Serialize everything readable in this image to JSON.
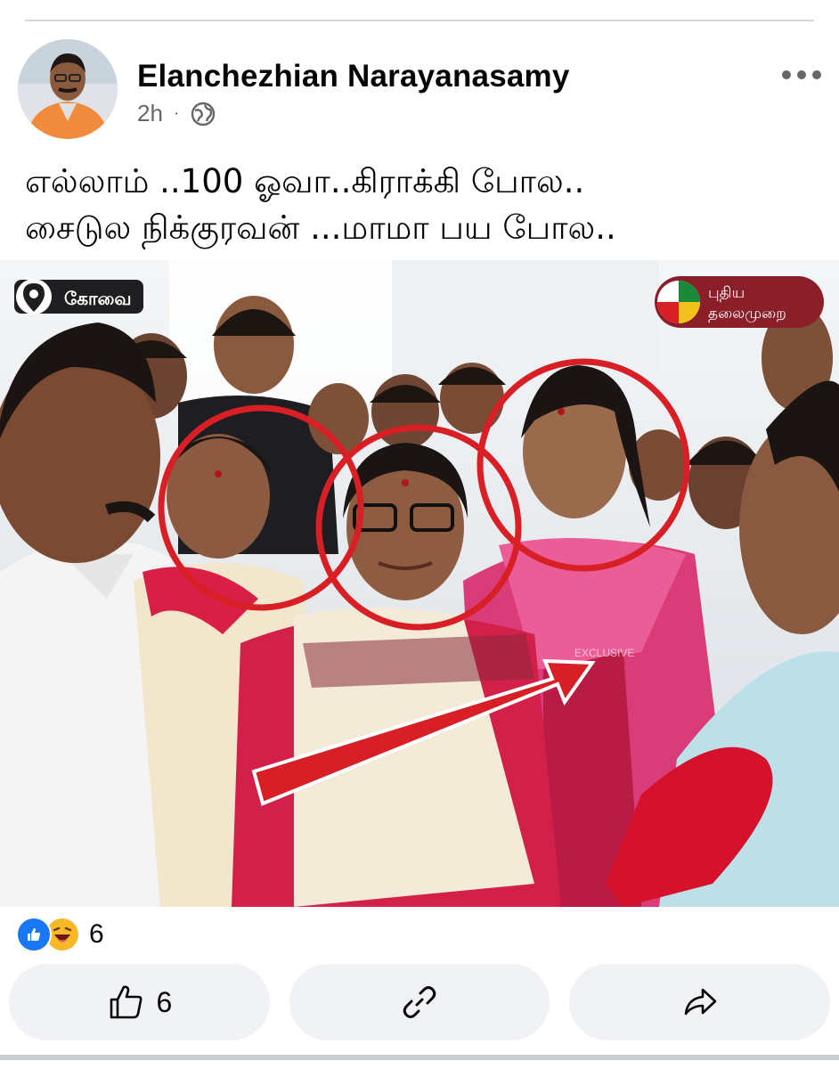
{
  "post": {
    "author": "Elanchezhian Narayanasamy",
    "time": "2h",
    "separator": "·",
    "audience_icon": "globe-icon",
    "menu_icon": "more-horizontal-icon",
    "caption_lines": [
      "எல்லாம் ..100 ஓவா..கிராக்கி போல..",
      "சைடுல நிக்குரவன் ...மாமா பய போல.."
    ]
  },
  "photo": {
    "location_tag": "கோவை",
    "channel_logo_line1": "புதிய",
    "channel_logo_line2": "தலைமுறை",
    "watermark": "EXCLUSIVE",
    "annotation_color": "#d81f26"
  },
  "reactions": {
    "icons": [
      "like-icon",
      "haha-icon"
    ],
    "count": "6"
  },
  "actions": {
    "like_count": "6",
    "like_icon": "thumbs-up-icon",
    "link_icon": "link-icon",
    "share_icon": "share-arrow-icon"
  },
  "colors": {
    "like_blue": "#1877f2",
    "secondary_text": "#65676b",
    "button_bg": "#f0f2f5"
  }
}
